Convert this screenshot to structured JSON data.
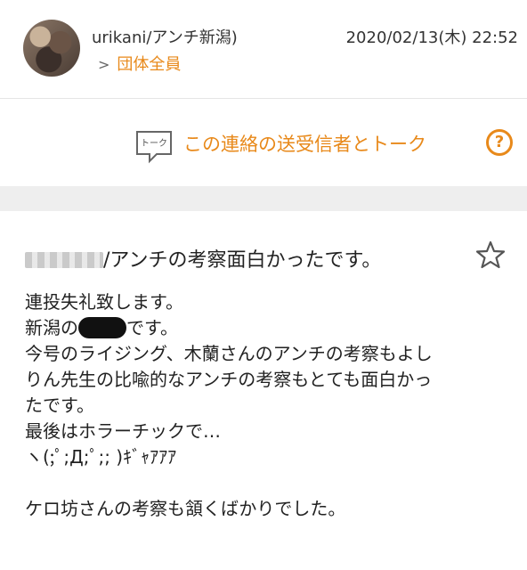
{
  "header": {
    "sender_name": "urikani/アンチ新潟)",
    "group_label": "団体全員",
    "datetime": "2020/02/13(木) 22:52"
  },
  "talk": {
    "icon_text": "トーク",
    "label": "この連絡の送受信者とトーク",
    "help_label": "?"
  },
  "message": {
    "title_suffix": "/アンチの考察面白かったです。",
    "lines": {
      "l1": "連投失礼致します。",
      "l2_a": "新潟の",
      "l2_b": "です。",
      "l3": "今号のライジング、木蘭さんのアンチの考察もよし",
      "l4": "りん先生の比喩的なアンチの考察もとても面白かっ",
      "l5": "たです。",
      "l6": "最後はホラーチックで…",
      "l7": "ヽ(;ﾟ;Д;ﾟ;; )ｷﾞｬｱｱｱ",
      "l8": "ケロ坊さんの考察も頷くばかりでした。"
    }
  },
  "colors": {
    "accent": "#e8891a",
    "band": "#eeeeee"
  },
  "icons": {
    "avatar": "avatar",
    "talk": "talk-bubble-icon",
    "help": "help-icon",
    "star": "star-icon",
    "chevron": "chevron-right-icon"
  }
}
